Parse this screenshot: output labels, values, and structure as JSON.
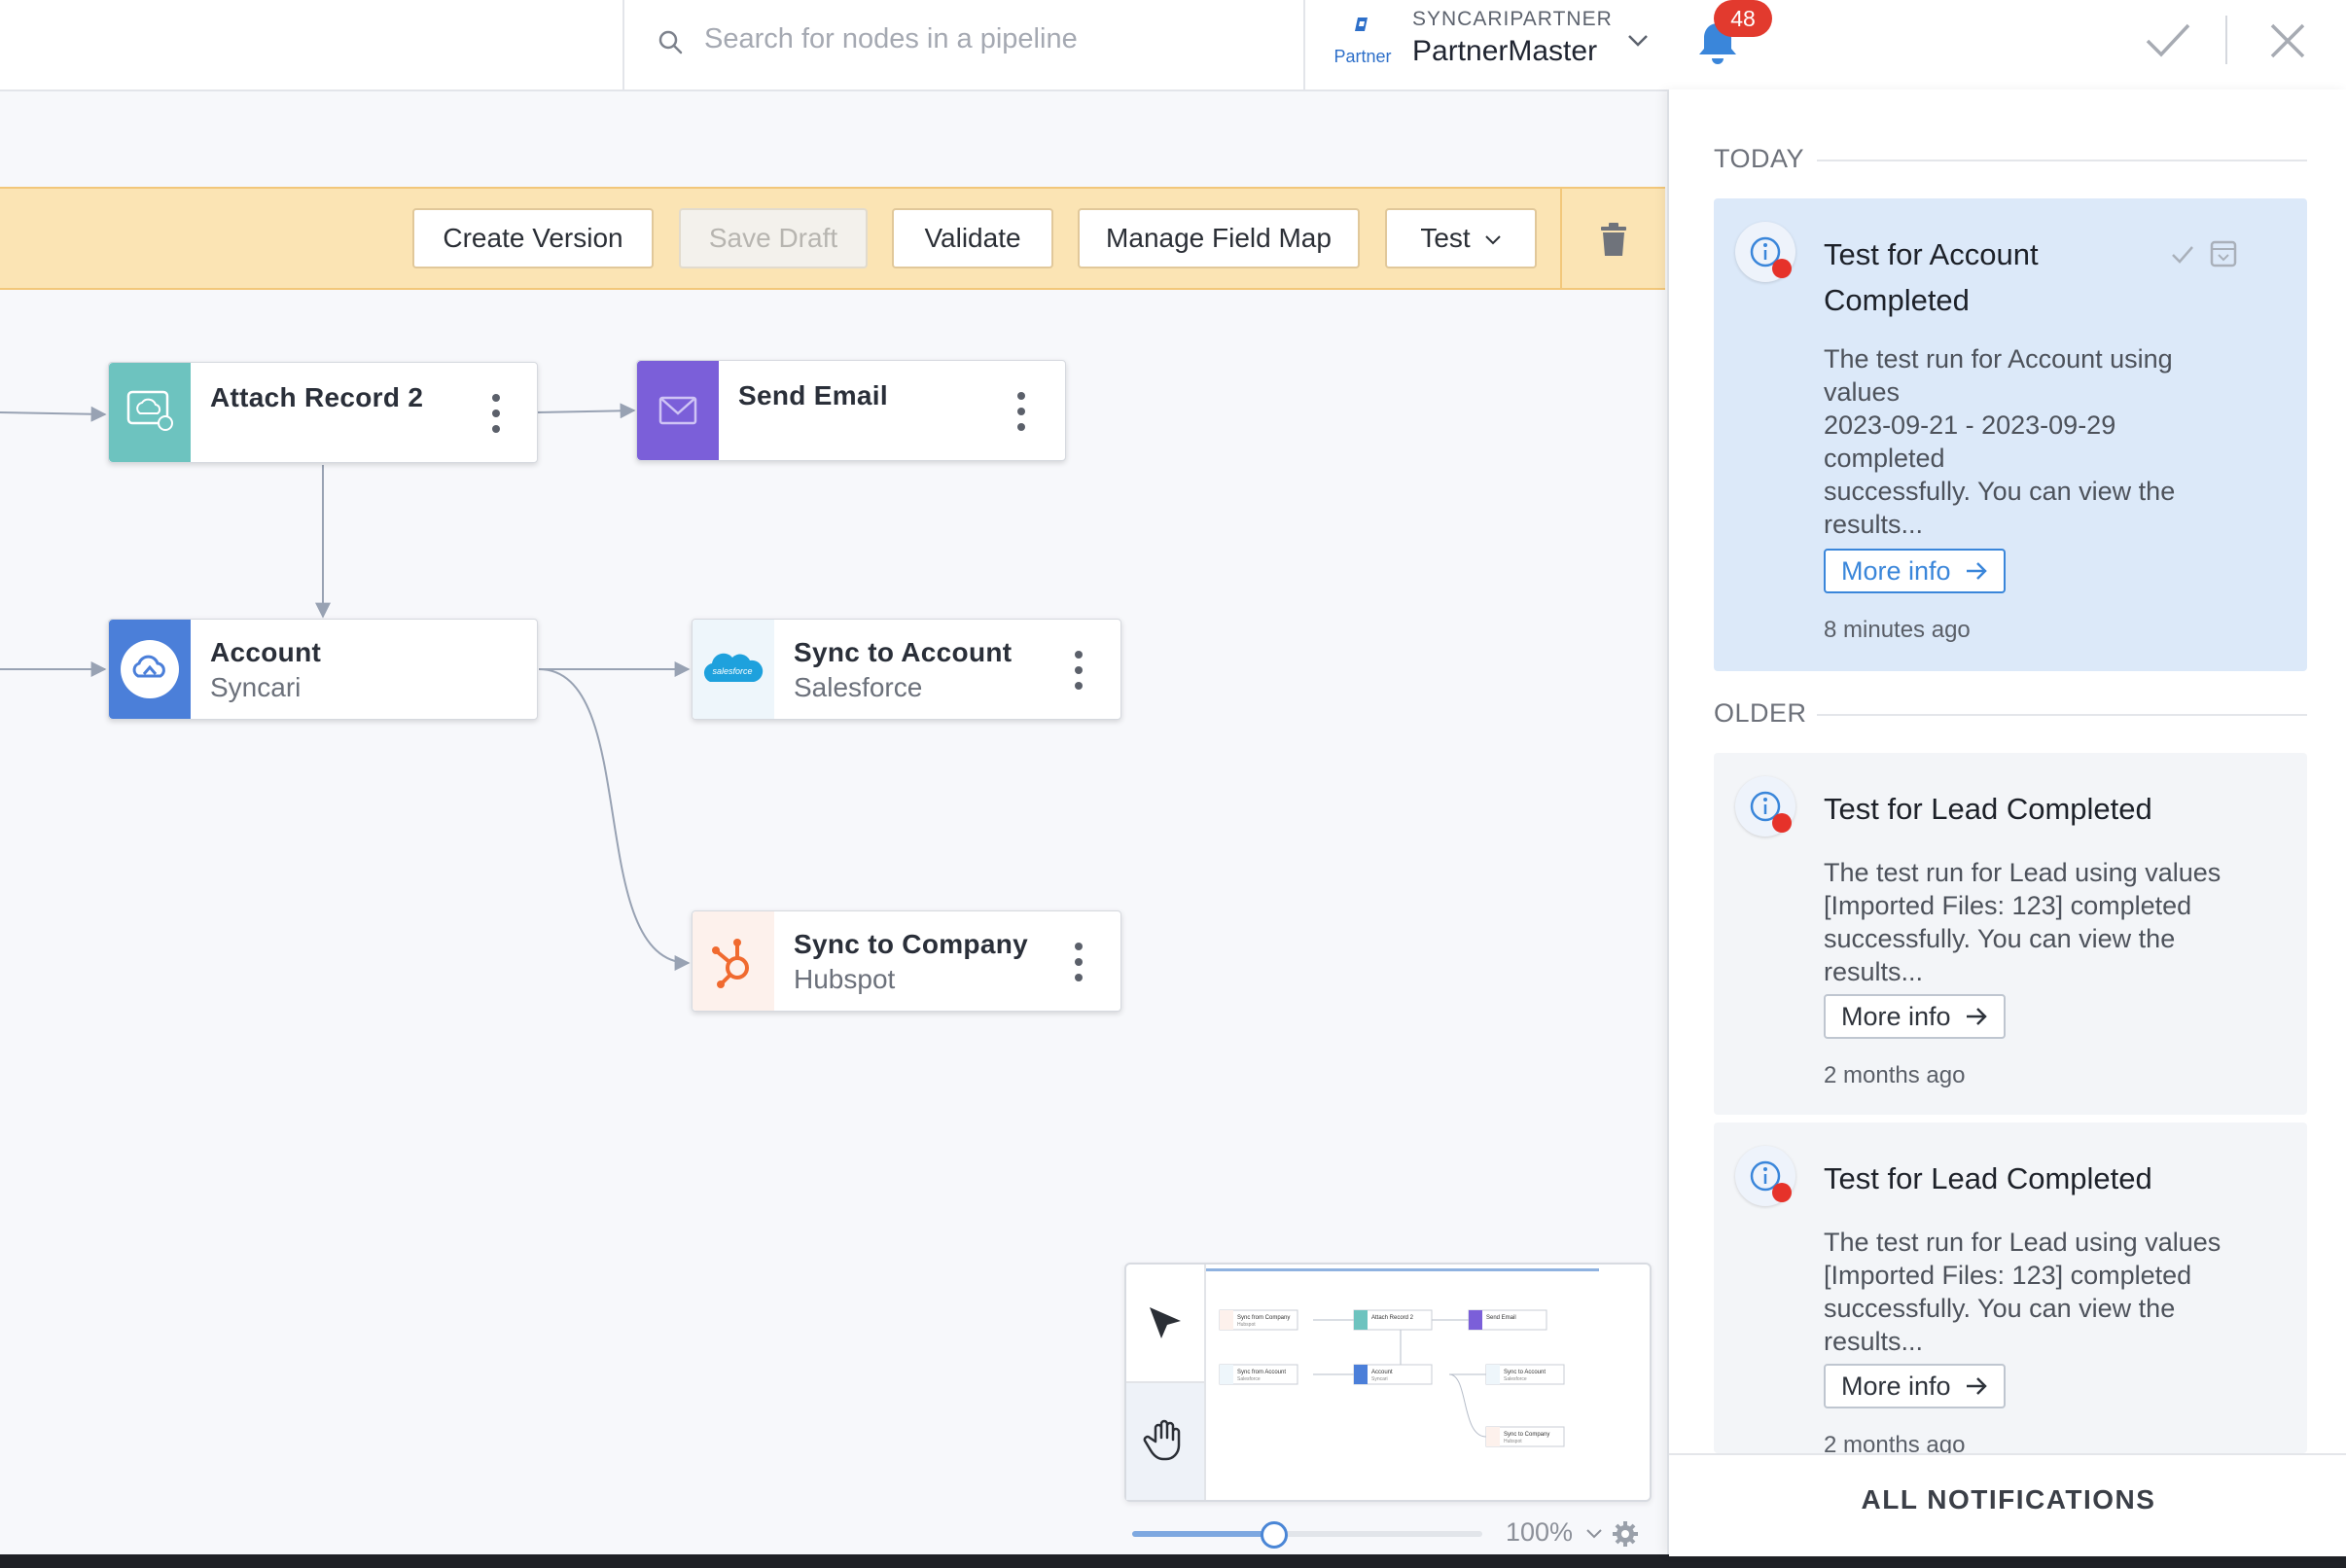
{
  "search": {
    "placeholder": "Search for nodes in a pipeline"
  },
  "account": {
    "org": "SYNCARIPARTNER",
    "user": "PartnerMaster",
    "logo_text": "Partner"
  },
  "notifications_badge": "48",
  "toolbar": {
    "create_version": "Create Version",
    "save_draft": "Save Draft",
    "validate": "Validate",
    "manage_field_map": "Manage Field Map",
    "test": "Test"
  },
  "nodes": {
    "attach_record": {
      "title": "Attach Record 2",
      "color": "#6dc3bf"
    },
    "send_email": {
      "title": "Send Email",
      "color": "#7b5fd9"
    },
    "account": {
      "title": "Account",
      "subtitle": "Syncari",
      "color": "#4b7fd9"
    },
    "sync_account": {
      "title": "Sync to Account",
      "subtitle": "Salesforce",
      "icon_text": "salesforce"
    },
    "sync_company": {
      "title": "Sync to  Company",
      "subtitle": "Hubspot"
    }
  },
  "minimap": {
    "nodes": [
      {
        "title": "Sync from Company",
        "subtitle": "Hubspot"
      },
      {
        "title": "Attach Record 2",
        "subtitle": ""
      },
      {
        "title": "Send Email",
        "subtitle": ""
      },
      {
        "title": "Sync from Account",
        "subtitle": "Salesforce"
      },
      {
        "title": "Account",
        "subtitle": "Syncari"
      },
      {
        "title": "Sync to Account",
        "subtitle": "Salesforce"
      },
      {
        "title": "Sync to Company",
        "subtitle": "Hubspot"
      }
    ]
  },
  "zoom": {
    "level": "100%",
    "fraction": 0.4
  },
  "panel": {
    "today_label": "TODAY",
    "older_label": "OLDER",
    "footer": "ALL NOTIFICATIONS",
    "today": [
      {
        "title": "Test for Account Completed",
        "body": [
          "The test run for Account using",
          "values",
          "2023-09-21 - 2023-09-29",
          "completed",
          "successfully. You can view the",
          "results..."
        ],
        "more": "More info",
        "time": "8 minutes ago"
      }
    ],
    "older": [
      {
        "title": "Test for Lead Completed",
        "body": [
          "The test run for Lead using values",
          "[Imported Files: 123] completed",
          "successfully. You can view the",
          "results..."
        ],
        "more": "More info",
        "time": "2 months ago"
      },
      {
        "title": "Test for Lead Completed",
        "body": [
          "The test run for Lead using values",
          "[Imported Files: 123] completed",
          "successfully. You can view the",
          "results..."
        ],
        "more": "More info",
        "time": "2 months ago"
      }
    ]
  }
}
